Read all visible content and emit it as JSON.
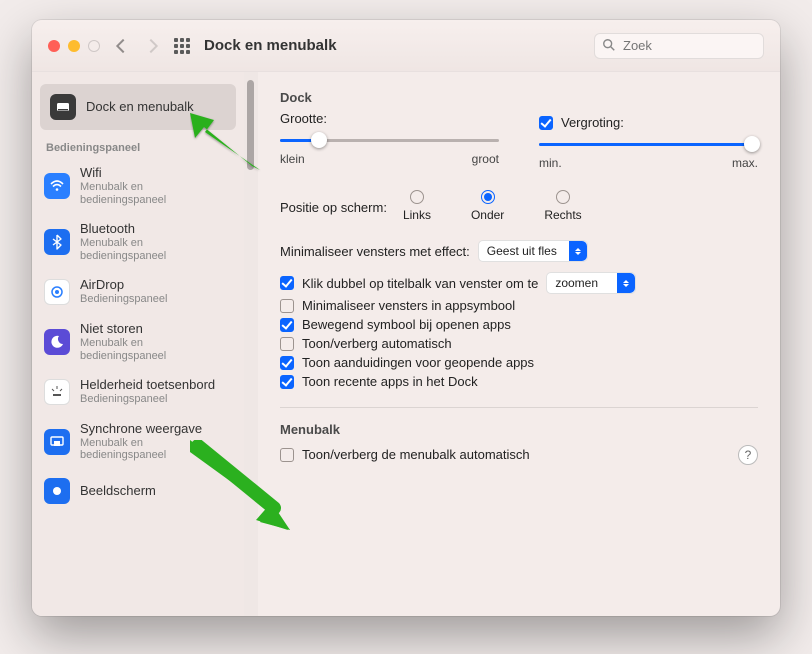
{
  "toolbar": {
    "title": "Dock en menubalk",
    "search_placeholder": "Zoek"
  },
  "sidebar": {
    "header0": "Bedieningspaneel",
    "items": [
      {
        "label": "Dock en menubalk",
        "sub": ""
      },
      {
        "label": "Wifi",
        "sub": "Menubalk en bedieningspaneel"
      },
      {
        "label": "Bluetooth",
        "sub": "Menubalk en bedieningspaneel"
      },
      {
        "label": "AirDrop",
        "sub": "Bedieningspaneel"
      },
      {
        "label": "Niet storen",
        "sub": "Menubalk en bedieningspaneel"
      },
      {
        "label": "Helderheid toetsenbord",
        "sub": "Bedieningspaneel"
      },
      {
        "label": "Synchrone weergave",
        "sub": "Menubalk en bedieningspaneel"
      },
      {
        "label": "Beeldscherm",
        "sub": ""
      }
    ]
  },
  "dock": {
    "section_title": "Dock",
    "size_label": "Grootte:",
    "size_min": "klein",
    "size_max": "groot",
    "size_value": 18,
    "mag_label": "Vergroting:",
    "mag_checked": true,
    "mag_min": "min.",
    "mag_max": "max.",
    "mag_value": 100,
    "position_label": "Positie op scherm:",
    "pos_options": [
      {
        "label": "Links",
        "checked": false
      },
      {
        "label": "Onder",
        "checked": true
      },
      {
        "label": "Rechts",
        "checked": false
      }
    ],
    "minimize_label": "Minimaliseer vensters met effect:",
    "minimize_value": "Geest uit fles",
    "doubleclick_pre": "Klik dubbel op titelbalk van venster om te",
    "doubleclick_checked": true,
    "doubleclick_value": "zoomen",
    "checks": [
      {
        "label": "Minimaliseer vensters in appsymbool",
        "checked": false
      },
      {
        "label": "Bewegend symbool bij openen apps",
        "checked": true
      },
      {
        "label": "Toon/verberg automatisch",
        "checked": false
      },
      {
        "label": "Toon aanduidingen voor geopende apps",
        "checked": true
      },
      {
        "label": "Toon recente apps in het Dock",
        "checked": true
      }
    ]
  },
  "menubar": {
    "section_title": "Menubalk",
    "auto_hide_label": "Toon/verberg de menubalk automatisch",
    "auto_hide_checked": false,
    "help": "?"
  }
}
